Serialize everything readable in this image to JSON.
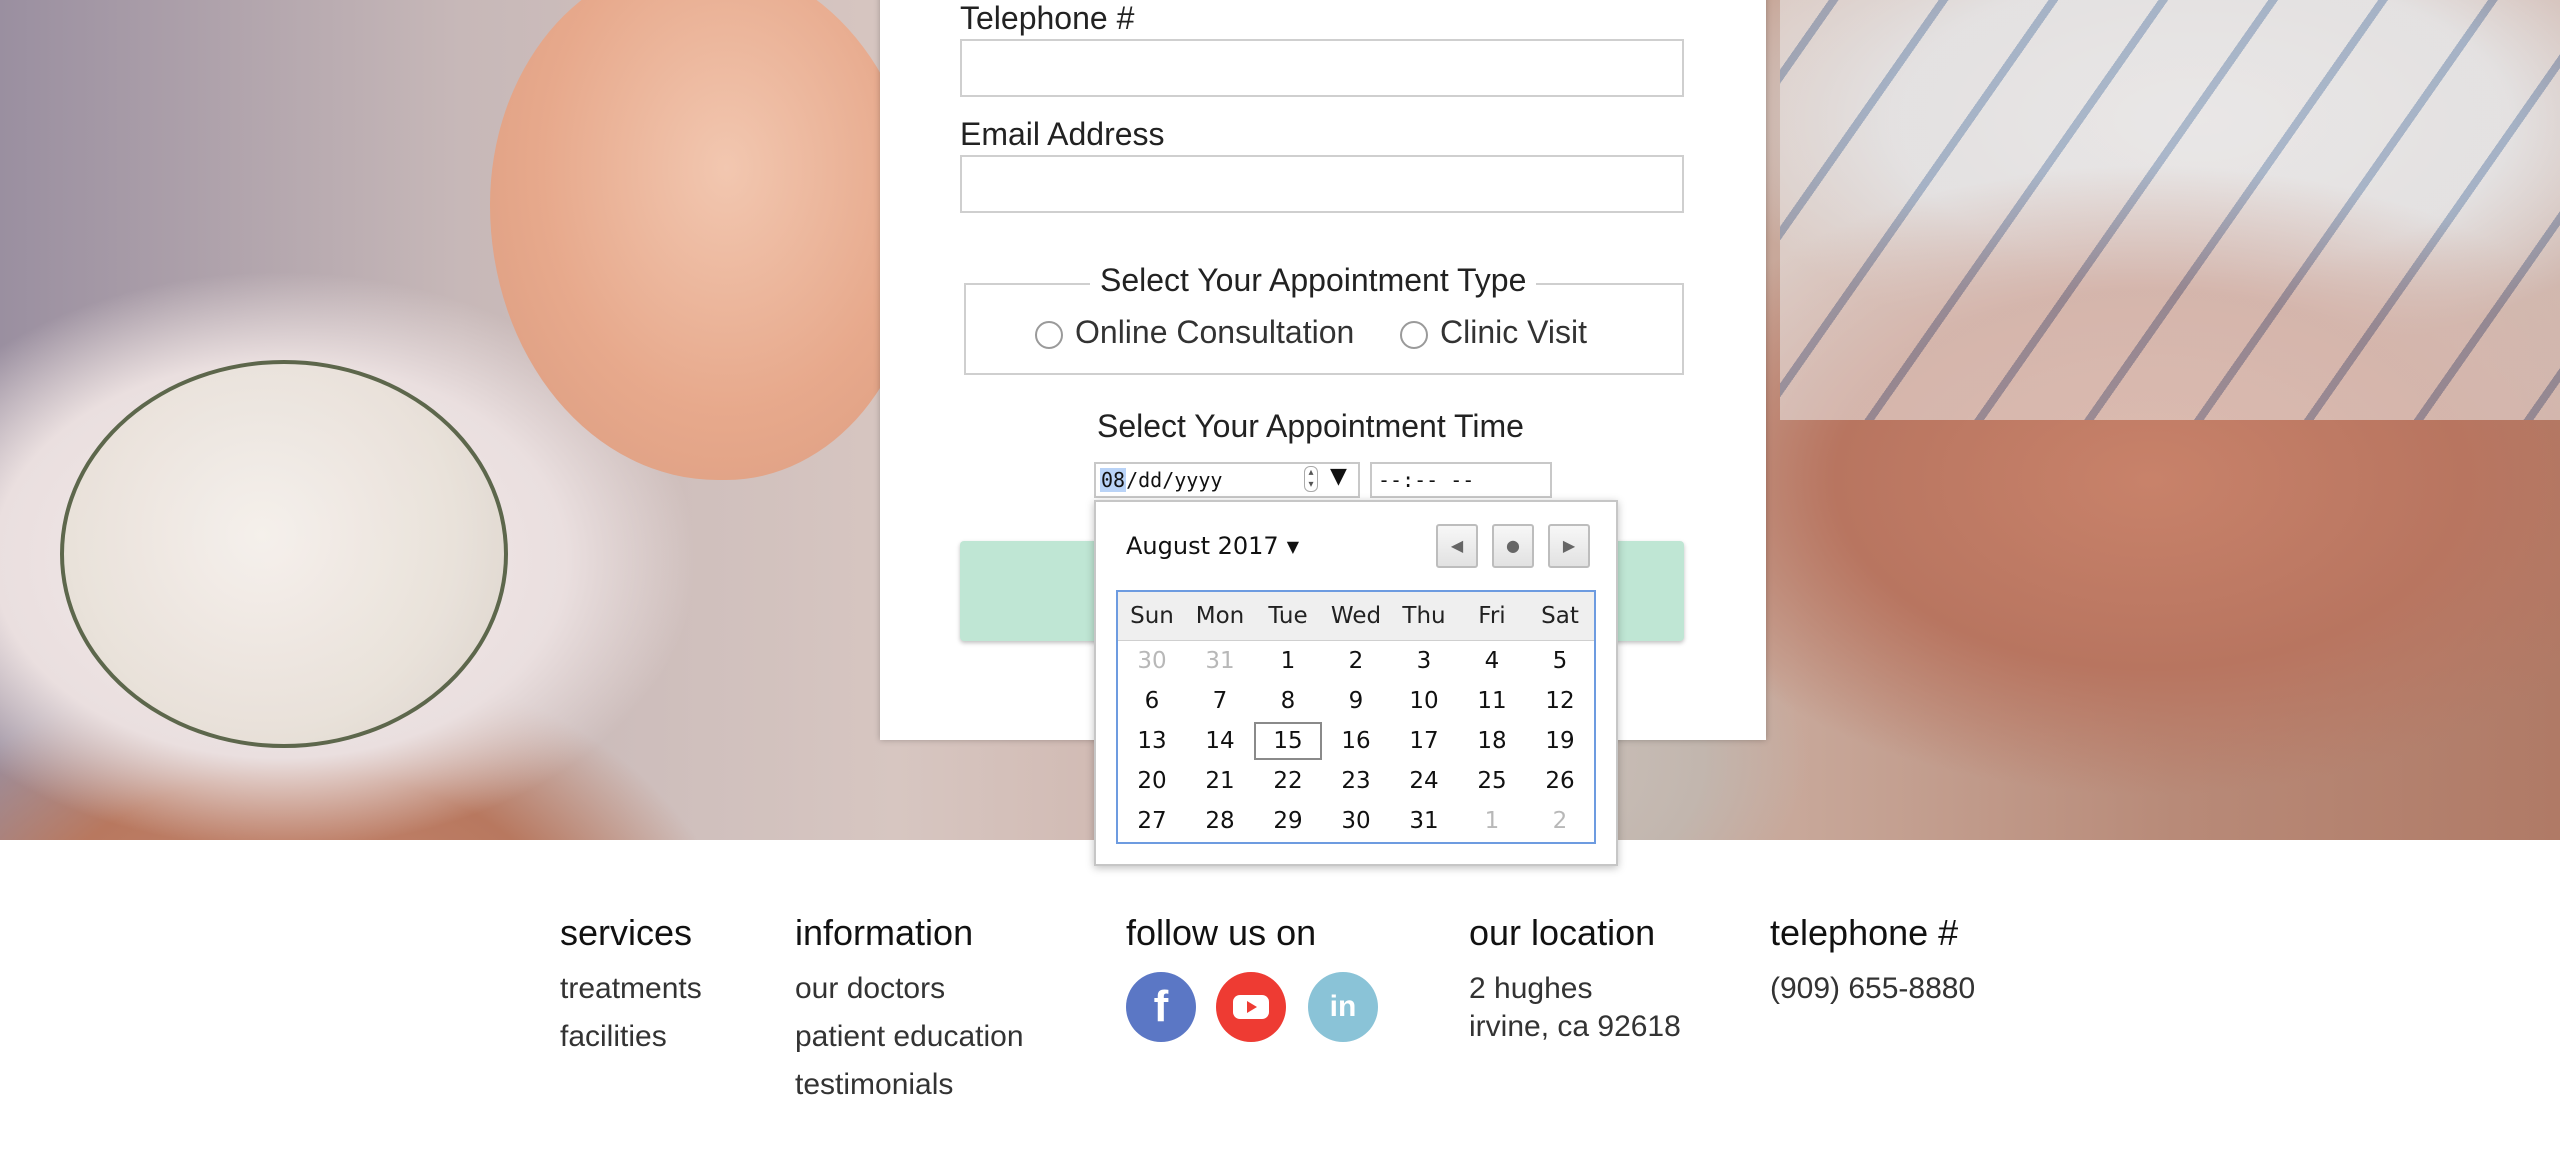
{
  "form": {
    "telephone_label": "Telephone #",
    "email_label": "Email Address",
    "appointment_type": {
      "legend": "Select Your Appointment Type",
      "options": [
        "Online Consultation",
        "Clinic Visit"
      ]
    },
    "appointment_time_label": "Select Your Appointment Time",
    "date_input": {
      "month": "08",
      "rest": "/dd/yyyy",
      "dropdown_icon": "triangle-down-icon",
      "spinner_icon": "spinner-icon"
    },
    "time_input": {
      "value": "--:-- --"
    }
  },
  "calendar": {
    "month_label": "August 2017",
    "nav_icons": [
      "prev-arrow-icon",
      "today-dot-icon",
      "next-arrow-icon"
    ],
    "weekdays": [
      "Sun",
      "Mon",
      "Tue",
      "Wed",
      "Thu",
      "Fri",
      "Sat"
    ],
    "weeks": [
      [
        "30",
        "31",
        "1",
        "2",
        "3",
        "4",
        "5"
      ],
      [
        "6",
        "7",
        "8",
        "9",
        "10",
        "11",
        "12"
      ],
      [
        "13",
        "14",
        "15",
        "16",
        "17",
        "18",
        "19"
      ],
      [
        "20",
        "21",
        "22",
        "23",
        "24",
        "25",
        "26"
      ],
      [
        "27",
        "28",
        "29",
        "30",
        "31",
        "1",
        "2"
      ]
    ],
    "today": "15"
  },
  "footer": {
    "services": {
      "heading": "services",
      "links": [
        "treatments",
        "facilities"
      ]
    },
    "information": {
      "heading": "information",
      "links": [
        "our doctors",
        "patient education",
        "testimonials"
      ]
    },
    "follow": {
      "heading": "follow us on",
      "icons": [
        "facebook-icon",
        "youtube-icon",
        "linkedin-icon"
      ]
    },
    "location": {
      "heading": "our location",
      "lines": [
        "2 hughes",
        "irvine, ca 92618"
      ]
    },
    "telephone": {
      "heading": "telephone #",
      "number": "(909) 655-8880"
    }
  },
  "colors": {
    "submit_button": "#bfe6d4",
    "facebook": "#5b77c5",
    "youtube": "#ee3b33",
    "linkedin": "#8ac3d7",
    "calendar_border": "#6d9be0"
  }
}
